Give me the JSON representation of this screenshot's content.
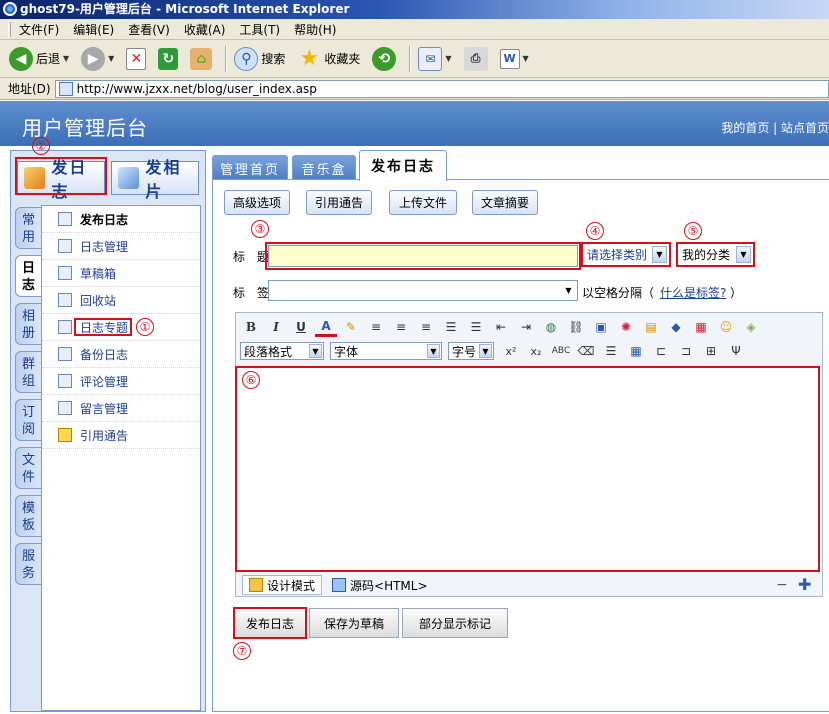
{
  "window": {
    "title": "ghost79-用户管理后台 - Microsoft Internet Explorer"
  },
  "menu": [
    "文件(F)",
    "编辑(E)",
    "查看(V)",
    "收藏(A)",
    "工具(T)",
    "帮助(H)"
  ],
  "toolbar": {
    "back": "后退",
    "search": "搜索",
    "favorites": "收藏夹"
  },
  "address": {
    "label": "地址(D)",
    "url": "http://www.jzxx.net/blog/user_index.asp"
  },
  "header": {
    "title": "用户管理后台",
    "links": "我的首页 | 站点首页"
  },
  "left": {
    "post_blog": "发日志",
    "post_photo": "发相片",
    "vtabs": [
      "常用",
      "日志",
      "相册",
      "群组",
      "订阅",
      "文件",
      "模板",
      "服务"
    ],
    "nav": [
      "发布日志",
      "日志管理",
      "草稿箱",
      "回收站",
      "日志专题",
      "备份日志",
      "评论管理",
      "留言管理",
      "引用通告"
    ]
  },
  "tabs": [
    "管理首页",
    "音乐盒",
    "发布日志"
  ],
  "ops": [
    "高级选项",
    "引用通告",
    "上传文件",
    "文章摘要"
  ],
  "form": {
    "title_label": "标 题",
    "title_value": "",
    "category_select": "请选择类别",
    "my_category_select": "我的分类",
    "tag_label": "标 签",
    "tag_hint": "以空格分隔（",
    "tag_link": "什么是标签?",
    "tag_hint_end": "）"
  },
  "editor": {
    "format_select": "段落格式",
    "font_select": "字体",
    "size_select": "字号",
    "design_mode": "设计模式",
    "source_mode": "源码<HTML>"
  },
  "actions": {
    "publish": "发布日志",
    "save_draft": "保存为草稿",
    "partial": "部分显示标记"
  },
  "markers": [
    "①",
    "②",
    "③",
    "④",
    "⑤",
    "⑥",
    "⑦"
  ],
  "colors": {
    "annotation_red": "#d4111a",
    "header_blue": "#3c6fb8",
    "title_input_bg": "#ffffcc",
    "link_blue": "#1c3e8a"
  }
}
